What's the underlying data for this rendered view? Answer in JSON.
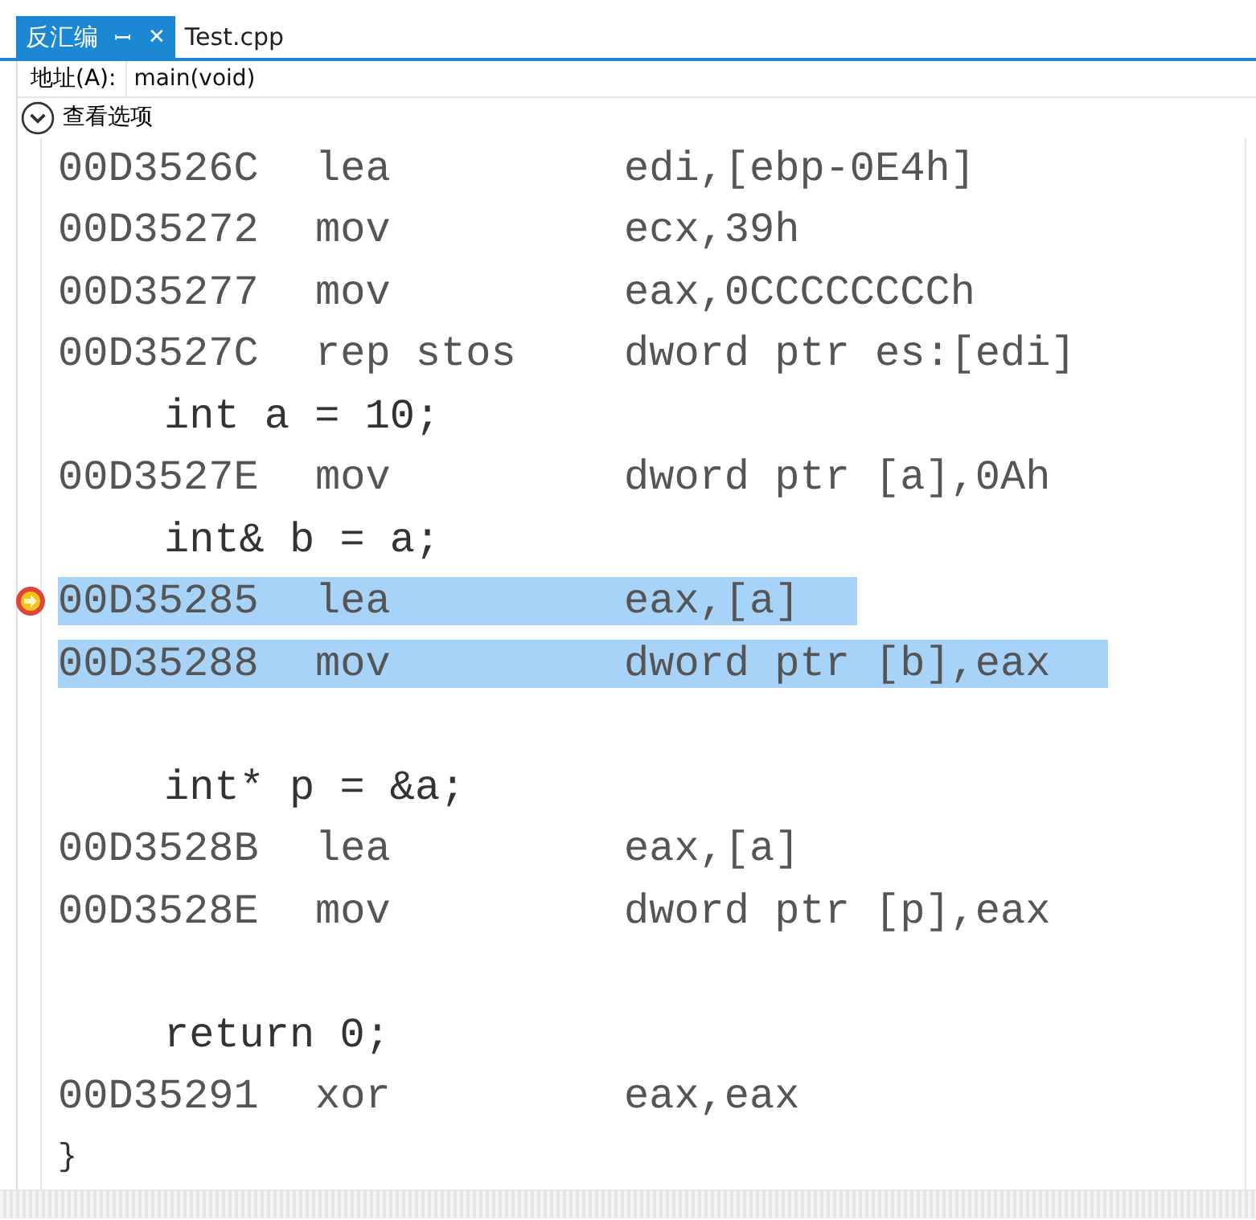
{
  "tabs": [
    {
      "label": "反汇编",
      "selected": true,
      "pin": "ꟷ",
      "close": "✕"
    },
    {
      "label": "Test.cpp",
      "selected": false
    }
  ],
  "address": {
    "label": "地址(A):",
    "value": "main(void)"
  },
  "view_options": {
    "label": "查看选项",
    "expanded": false
  },
  "lines": [
    {
      "kind": "asm",
      "address": "00D3526C",
      "op": "lea",
      "operands": "edi,[ebp-0E4h]",
      "selected": false,
      "current": false
    },
    {
      "kind": "asm",
      "address": "00D35272",
      "op": "mov",
      "operands": "ecx,39h",
      "selected": false,
      "current": false
    },
    {
      "kind": "asm",
      "address": "00D35277",
      "op": "mov",
      "operands": "eax,0CCCCCCCCh",
      "selected": false,
      "current": false
    },
    {
      "kind": "asm",
      "address": "00D3527C",
      "op": "rep stos",
      "operands": "dword ptr es:[edi]",
      "selected": false,
      "current": false
    },
    {
      "kind": "source",
      "text": "int a = 10;"
    },
    {
      "kind": "asm",
      "address": "00D3527E",
      "op": "mov",
      "operands": "dword ptr [a],0Ah",
      "selected": false,
      "current": false
    },
    {
      "kind": "source",
      "text": "int& b = a;"
    },
    {
      "kind": "asm",
      "address": "00D35285",
      "op": "lea",
      "operands": "eax,[a]",
      "selected": true,
      "current": true
    },
    {
      "kind": "asm",
      "address": "00D35288",
      "op": "mov",
      "operands": "dword ptr [b],eax",
      "selected": true,
      "current": false
    },
    {
      "kind": "blank"
    },
    {
      "kind": "source",
      "text": "int* p = &a;"
    },
    {
      "kind": "asm",
      "address": "00D3528B",
      "op": "lea",
      "operands": "eax,[a]",
      "selected": false,
      "current": false
    },
    {
      "kind": "asm",
      "address": "00D3528E",
      "op": "mov",
      "operands": "dword ptr [p],eax",
      "selected": false,
      "current": false
    },
    {
      "kind": "blank"
    },
    {
      "kind": "source",
      "text": "return 0;"
    },
    {
      "kind": "asm",
      "address": "00D35291",
      "op": "xor",
      "operands": "eax,eax",
      "selected": false,
      "current": false
    },
    {
      "kind": "close",
      "text": "}"
    }
  ]
}
